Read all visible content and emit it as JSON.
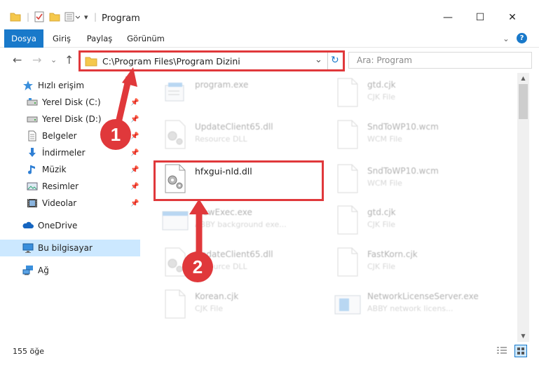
{
  "window": {
    "title": "Program",
    "minimize": "—",
    "maximize": "☐",
    "close": "✕"
  },
  "ribbon": {
    "tabs": [
      {
        "label": "Dosya",
        "active": true
      },
      {
        "label": "Giriş",
        "active": false
      },
      {
        "label": "Paylaş",
        "active": false
      },
      {
        "label": "Görünüm",
        "active": false
      }
    ],
    "expand": "⌄",
    "help": "?"
  },
  "nav": {
    "back": "←",
    "forward": "→",
    "recent": "⌄",
    "up": "↑"
  },
  "address": {
    "path": "C:\\Program Files\\Program Dizini",
    "dropdown": "⌄",
    "refresh": "↻"
  },
  "search": {
    "placeholder": "Ara: Program",
    "icon": "⌕"
  },
  "sidebar": {
    "items": [
      {
        "label": "Hızlı erişim",
        "icon": "star-icon",
        "pinned": false
      },
      {
        "label": "Yerel Disk (C:)",
        "icon": "drive-icon",
        "pinned": true
      },
      {
        "label": "Yerel Disk (D:)",
        "icon": "drive-icon",
        "pinned": true
      },
      {
        "label": "Belgeler",
        "icon": "document-icon",
        "pinned": true
      },
      {
        "label": "İndirmeler",
        "icon": "download-icon",
        "pinned": true
      },
      {
        "label": "Müzik",
        "icon": "music-icon",
        "pinned": true
      },
      {
        "label": "Resimler",
        "icon": "picture-icon",
        "pinned": true
      },
      {
        "label": "Videolar",
        "icon": "video-icon",
        "pinned": true
      },
      {
        "label": "OneDrive",
        "icon": "cloud-icon",
        "pinned": false
      },
      {
        "label": "Bu bilgisayar",
        "icon": "computer-icon",
        "pinned": false
      },
      {
        "label": "Ağ",
        "icon": "network-icon",
        "pinned": false
      }
    ],
    "pin_glyph": "📌"
  },
  "files": {
    "left": [
      {
        "name": "program.exe",
        "type": ""
      },
      {
        "name": "UpdateClient65.dll",
        "type": "Resource DLL"
      },
      {
        "name": "hfxgui-nld.dll",
        "type": ""
      },
      {
        "name": "ViewExec.exe",
        "type": "ABBY background exe..."
      },
      {
        "name": "UpdateClient65.dll",
        "type": "Resource DLL"
      },
      {
        "name": "Korean.cjk",
        "type": "CJK File"
      }
    ],
    "right": [
      {
        "name": "gtd.cjk",
        "type": "CJK File"
      },
      {
        "name": "SndToWP10.wcm",
        "type": "WCM File"
      },
      {
        "name": "SndToWP10.wcm",
        "type": "WCM File"
      },
      {
        "name": "gtd.cjk",
        "type": "CJK File"
      },
      {
        "name": "FastKorn.cjk",
        "type": "CJK File"
      },
      {
        "name": "NetworkLicenseServer.exe",
        "type": "ABBY network licens..."
      }
    ]
  },
  "status": {
    "count": "155 öğe"
  },
  "annotations": {
    "step1": "1",
    "step2": "2",
    "color": "#e0383b"
  }
}
